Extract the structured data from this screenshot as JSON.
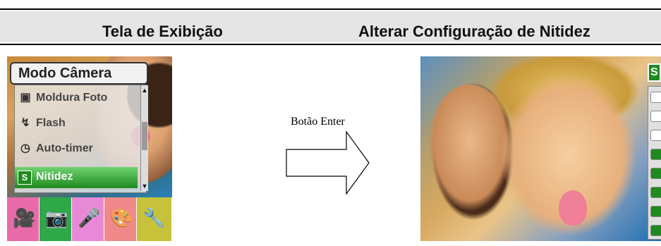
{
  "header": {
    "left_title": "Tela de Exibição",
    "right_title": "Alterar Configuração de Nitidez"
  },
  "camera_menu": {
    "title": "Modo Câmera",
    "items": [
      {
        "label": "Moldura Foto",
        "icon": "portrait-frame-icon"
      },
      {
        "label": "Flash",
        "icon": "flash-icon"
      },
      {
        "label": "Auto-timer",
        "icon": "timer-icon"
      },
      {
        "label": "Nitidez",
        "icon": "sharpness-icon",
        "icon_glyph": "S",
        "selected": true
      }
    ],
    "tabs": [
      {
        "name": "video-mode-tab",
        "icon": "camcorder-icon",
        "color": "#e86aa8"
      },
      {
        "name": "camera-mode-tab",
        "icon": "camera-icon",
        "color": "#2fa84a",
        "active": true
      },
      {
        "name": "voice-mode-tab",
        "icon": "microphone-icon",
        "color": "#e889d8"
      },
      {
        "name": "effects-tab",
        "icon": "palette-icon",
        "color": "#f08a8a"
      },
      {
        "name": "settings-tab",
        "icon": "tools-icon",
        "color": "#c7c23a"
      }
    ]
  },
  "transition": {
    "label": "Botão Enter"
  },
  "sharpness_screen": {
    "badge": "S",
    "level_bars_active": 5,
    "level_bars_total": 8
  },
  "colors": {
    "selection_green": "#1f8a1f",
    "header_bg": "#e5e5e5"
  }
}
